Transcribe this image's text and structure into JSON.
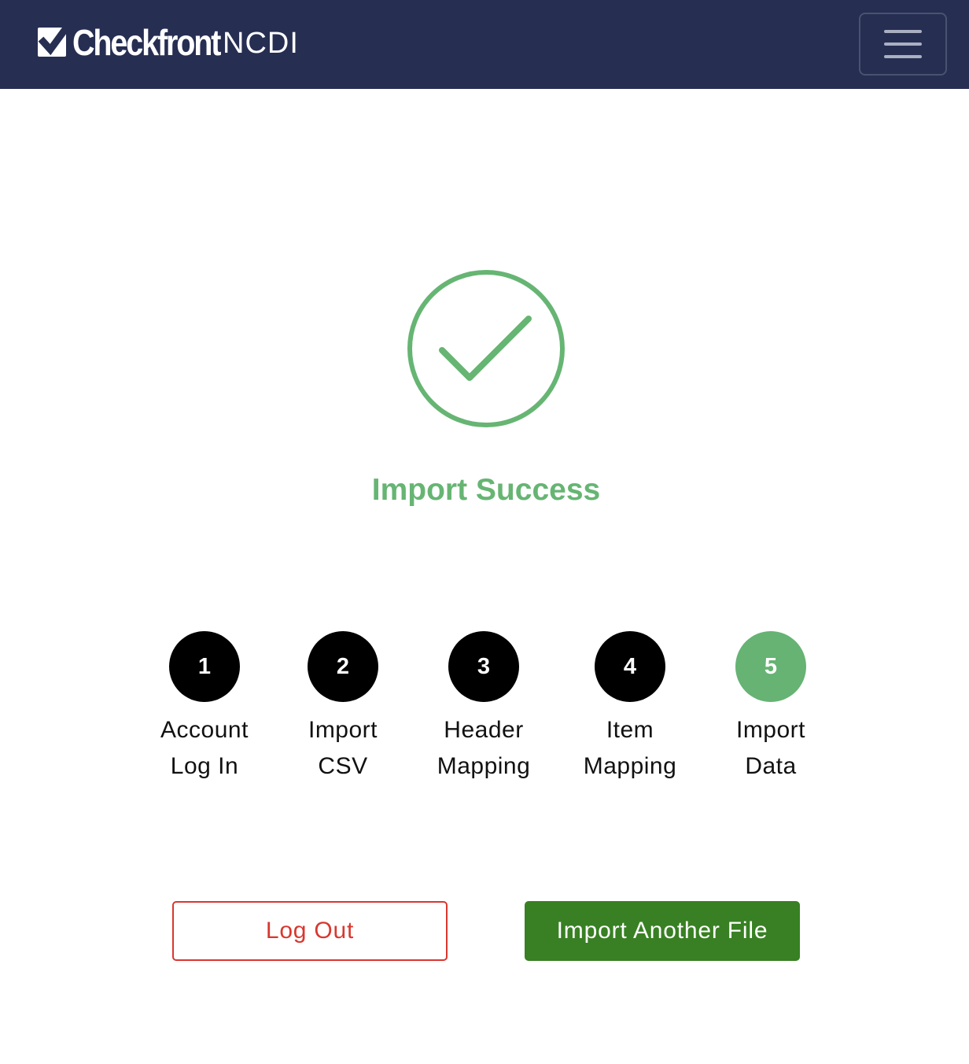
{
  "header": {
    "brand": "Checkfront",
    "subtitle": "NCDI",
    "menu_icon": "hamburger-menu-icon"
  },
  "status": {
    "icon": "check-circle-icon",
    "title": "Import Success",
    "color": "#66b573"
  },
  "steps": [
    {
      "number": "1",
      "line1": "Account",
      "line2": "Log In",
      "state": "done"
    },
    {
      "number": "2",
      "line1": "Import",
      "line2": "CSV",
      "state": "done"
    },
    {
      "number": "3",
      "line1": "Header",
      "line2": "Mapping",
      "state": "done"
    },
    {
      "number": "4",
      "line1": "Item",
      "line2": "Mapping",
      "state": "done"
    },
    {
      "number": "5",
      "line1": "Import",
      "line2": "Data",
      "state": "active"
    }
  ],
  "actions": {
    "logout_label": "Log Out",
    "import_another_label": "Import Another File"
  },
  "colors": {
    "navbar": "#262e52",
    "step_done": "#000000",
    "step_active": "#66b373",
    "logout": "#d9372f",
    "primary": "#388023"
  }
}
